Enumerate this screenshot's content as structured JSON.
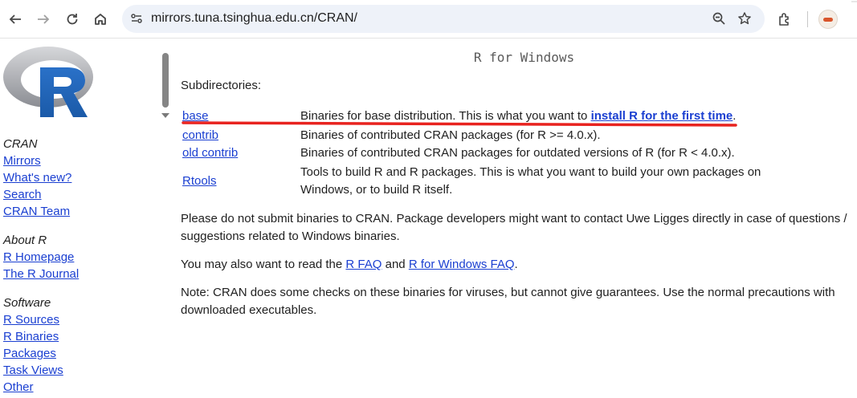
{
  "browser": {
    "url": "mirrors.tuna.tsinghua.edu.cn/CRAN/",
    "icons": [
      "back-icon",
      "forward-icon",
      "reload-icon",
      "home-icon",
      "site-info-icon",
      "zoom-icon",
      "bookmark-star-icon",
      "extensions-icon",
      "avatar-icon"
    ]
  },
  "sidebar": {
    "logo": "R",
    "sections": [
      {
        "heading": "CRAN",
        "links": [
          "Mirrors",
          "What's new?",
          "Search",
          "CRAN Team"
        ]
      },
      {
        "heading": "About R",
        "links": [
          "R Homepage",
          "The R Journal"
        ]
      },
      {
        "heading": "Software",
        "links": [
          "R Sources",
          "R Binaries",
          "Packages",
          "Task Views",
          "Other"
        ]
      }
    ]
  },
  "main": {
    "title": "R for Windows",
    "subdirectories_label": "Subdirectories:",
    "dirs": [
      {
        "name": "base",
        "desc_before": "Binaries for base distribution. This is what you want to ",
        "desc_link": "install R for the first time",
        "desc_after": "."
      },
      {
        "name": "contrib",
        "desc_before": "Binaries of contributed CRAN packages (for R >= 4.0.x).",
        "desc_link": "",
        "desc_after": ""
      },
      {
        "name": "old contrib",
        "desc_before": "Binaries of contributed CRAN packages for outdated versions of R (for R < 4.0.x).",
        "desc_link": "",
        "desc_after": ""
      },
      {
        "name": "Rtools",
        "desc_before": "Tools to build R and R packages. This is what you want to build your own packages on Windows, or to build R itself.",
        "desc_link": "",
        "desc_after": ""
      }
    ],
    "para1": "Please do not submit binaries to CRAN. Package developers might want to contact Uwe Ligges directly in case of questions / suggestions related to Windows binaries.",
    "para2": {
      "before": "You may also want to read the ",
      "link1": "R FAQ",
      "middle": " and ",
      "link2": "R for Windows FAQ",
      "after": "."
    },
    "para3": "Note: CRAN does some checks on these binaries for viruses, but cannot give guarantees. Use the normal precautions with downloaded executables."
  },
  "colors": {
    "link": "#1a3fd1",
    "highlight": "#e8231f",
    "r_logo_blue": "#2266b8"
  }
}
